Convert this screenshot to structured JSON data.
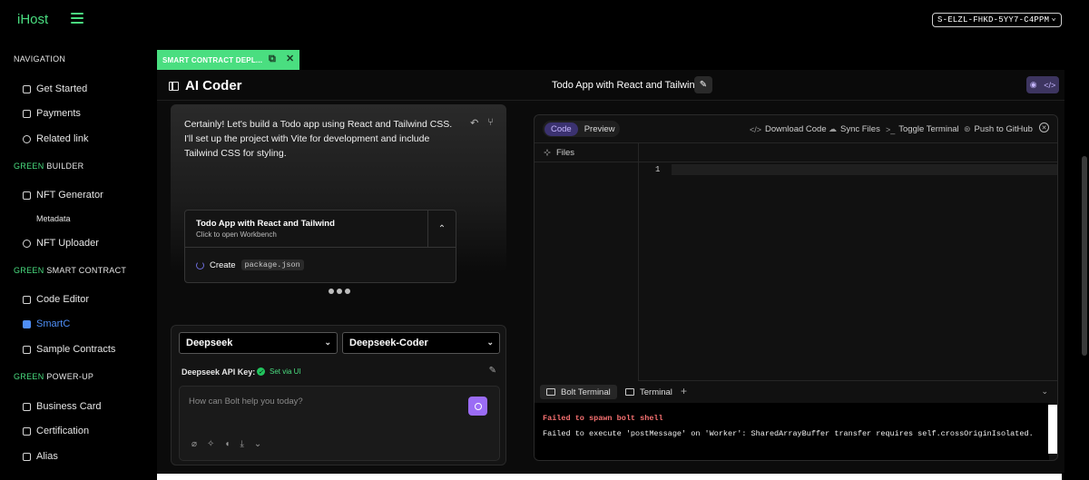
{
  "app": {
    "logo": "iHost",
    "wallet": "S-ELZL-FHKD-5YY7-C4PPM"
  },
  "sidebar": {
    "sections": [
      {
        "green": "",
        "title": "NAVIGATION"
      },
      {
        "green": "GREEN",
        "title": "BUILDER"
      },
      {
        "green": "GREEN",
        "title": "SMART CONTRACT"
      },
      {
        "green": "GREEN",
        "title": "POWER-UP"
      }
    ],
    "items": [
      {
        "label": "Get Started"
      },
      {
        "label": "Payments"
      },
      {
        "label": "Related link"
      },
      {
        "label": "NFT Generator"
      },
      {
        "label": "Metadata"
      },
      {
        "label": "NFT Uploader"
      },
      {
        "label": "Code Editor"
      },
      {
        "label": "SmartC"
      },
      {
        "label": "Sample Contracts"
      },
      {
        "label": "Business Card"
      },
      {
        "label": "Certification"
      },
      {
        "label": "Alias"
      }
    ],
    "active_item": "SmartC"
  },
  "tab": {
    "label": "SMART CONTRACT DEPL..."
  },
  "header": {
    "title": "AI Coder",
    "project_title": "Todo App with React and Tailwind"
  },
  "chat": {
    "message": "Certainly! Let's build a Todo app using React and Tailwind CSS. I'll set up the project with Vite for development and include Tailwind CSS for styling.",
    "artifact": {
      "title": "Todo App with React and Tailwind",
      "subtitle": "Click to open Workbench",
      "action_label": "Create",
      "action_file": "package.json"
    }
  },
  "prompt": {
    "provider": "Deepseek",
    "model": "Deepseek-Coder",
    "api_key_label": "Deepseek API Key:",
    "api_key_status": "Set via UI",
    "placeholder": "How can Bolt help you today?"
  },
  "workbench": {
    "tabs": [
      "Code",
      "Preview"
    ],
    "active_tab": "Code",
    "actions": [
      "Download Code",
      "Sync Files",
      "Toggle Terminal",
      "Push to GitHub"
    ],
    "files_label": "Files",
    "line_number": "1",
    "terminal_tabs": [
      "Bolt Terminal",
      "Terminal"
    ],
    "terminal_lines": [
      "Failed to spawn bolt shell",
      "Failed to execute 'postMessage' on 'Worker': SharedArrayBuffer transfer requires self.crossOriginIsolated."
    ]
  },
  "colors": {
    "accent": "#4ade80",
    "active": "#4f8ff7",
    "purple": "#9b6cf5",
    "error": "#f87171"
  }
}
